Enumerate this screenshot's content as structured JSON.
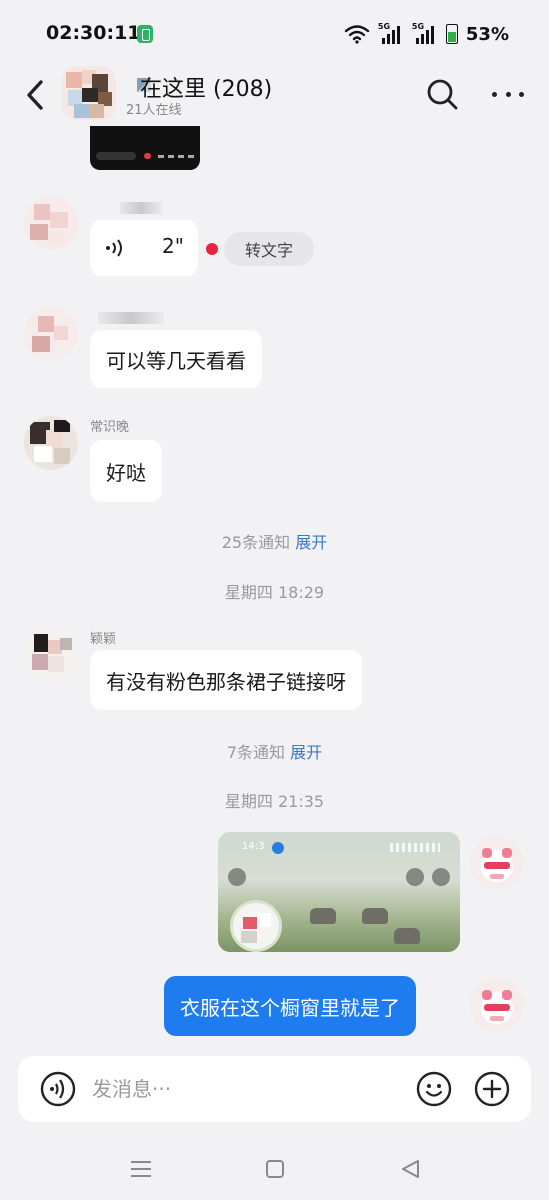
{
  "status_bar": {
    "time": "02:30:11",
    "network_1": "5G",
    "network_2": "5G",
    "battery_percent": "53%",
    "battery_level": 0.53
  },
  "header": {
    "title": "在这里 (208)",
    "subtitle": "21人在线",
    "icons": [
      "back-arrow-icon",
      "search-icon",
      "more-icon"
    ]
  },
  "messages": [
    {
      "type": "voice",
      "sender": "",
      "duration": "2\"",
      "transcribe_label": "转文字",
      "unread": true
    },
    {
      "type": "text",
      "sender": "",
      "text": "可以等几天看看"
    },
    {
      "type": "text",
      "sender": "常识晚",
      "text": "好哒"
    },
    {
      "type": "notice",
      "text": "25条通知",
      "link": "展开"
    },
    {
      "type": "time",
      "text": "星期四 18:29"
    },
    {
      "type": "text",
      "sender": "颖颖",
      "text": "有没有粉色那条裙子链接呀"
    },
    {
      "type": "notice",
      "text": "7条通知",
      "link": "展开"
    },
    {
      "type": "time",
      "text": "星期四 21:35"
    },
    {
      "type": "image",
      "outgoing": true,
      "status_time": "14:3"
    },
    {
      "type": "text",
      "outgoing": true,
      "text": "衣服在这个橱窗里就是了"
    }
  ],
  "input": {
    "placeholder": "发消息···",
    "value": ""
  },
  "colors": {
    "background": "#f2f2f4",
    "outgoing_bubble": "#1e7bf0",
    "link": "#3a78c9",
    "unread_dot": "#e8233f"
  },
  "nav": [
    "menu-icon",
    "home-icon",
    "back-icon"
  ]
}
